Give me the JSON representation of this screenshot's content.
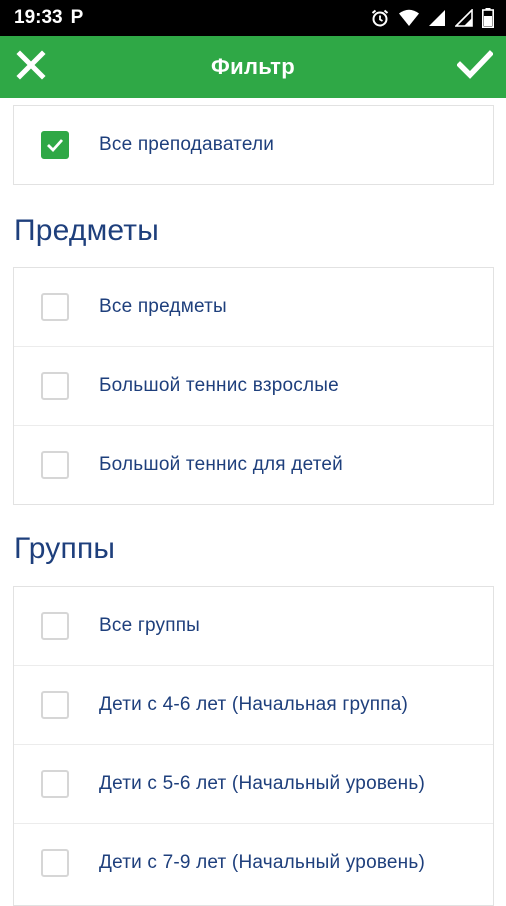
{
  "status_bar": {
    "time": "19:33",
    "app_badge": "P",
    "icons": [
      "alarm-icon",
      "wifi-icon",
      "signal-icon",
      "signal-icon",
      "battery-icon"
    ]
  },
  "app_bar": {
    "title": "Фильтр",
    "close_icon": "close-icon",
    "confirm_icon": "check-icon",
    "color": "#2fa846"
  },
  "teachers": {
    "items": [
      {
        "label": "Все преподаватели",
        "checked": true
      }
    ]
  },
  "subjects": {
    "title": "Предметы",
    "items": [
      {
        "label": "Все предметы",
        "checked": false
      },
      {
        "label": "Большой теннис взрослые",
        "checked": false
      },
      {
        "label": "Большой теннис для детей",
        "checked": false
      }
    ]
  },
  "groups": {
    "title": "Группы",
    "items": [
      {
        "label": "Все группы",
        "checked": false
      },
      {
        "label": "Дети с 4-6 лет (Начальная группа)",
        "checked": false
      },
      {
        "label": "Дети с 5-6 лет (Начальный уровень)",
        "checked": false
      },
      {
        "label": "Дети с 7-9 лет (Начальный уровень)",
        "checked": false
      }
    ]
  },
  "colors": {
    "accent": "#2fa846",
    "text": "#1e3f7c"
  }
}
